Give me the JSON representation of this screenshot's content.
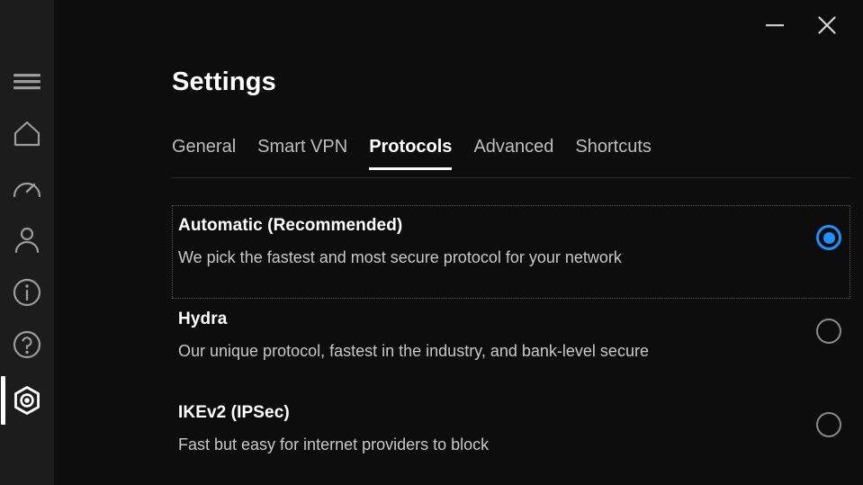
{
  "window": {
    "minimize_label": "—",
    "close_label": "✕",
    "minimize_icon": "minimize-icon",
    "close_icon": "close-icon"
  },
  "sidebar": {
    "background": "#1c1c1c",
    "active_indicator_color": "#ffffff",
    "items": [
      {
        "name": "menu",
        "icon": "hamburger-menu-icon",
        "active": false
      },
      {
        "name": "home",
        "icon": "home-icon",
        "active": false
      },
      {
        "name": "speed",
        "icon": "speedometer-icon",
        "active": false
      },
      {
        "name": "account",
        "icon": "person-icon",
        "active": false
      },
      {
        "name": "info",
        "icon": "info-circle-icon",
        "active": false
      },
      {
        "name": "help",
        "icon": "question-circle-icon",
        "active": false
      },
      {
        "name": "settings",
        "icon": "gear-hexagon-icon",
        "active": true
      }
    ]
  },
  "header": {
    "title": "Settings"
  },
  "tabs": [
    {
      "label": "General",
      "active": false
    },
    {
      "label": "Smart VPN",
      "active": false
    },
    {
      "label": "Protocols",
      "active": true
    },
    {
      "label": "Advanced",
      "active": false
    },
    {
      "label": "Shortcuts",
      "active": false
    }
  ],
  "protocols": {
    "selected": "Automatic (Recommended)",
    "accent_color": "#1e90ff",
    "options": [
      {
        "name": "Automatic (Recommended)",
        "description": "We pick the fastest and most secure protocol for your network",
        "selected": true,
        "focused": true
      },
      {
        "name": "Hydra",
        "description": "Our unique protocol, fastest in the industry, and bank-level secure",
        "selected": false,
        "focused": false
      },
      {
        "name": "IKEv2 (IPSec)",
        "description": "Fast but easy for internet providers to block",
        "selected": false,
        "focused": false
      }
    ]
  }
}
